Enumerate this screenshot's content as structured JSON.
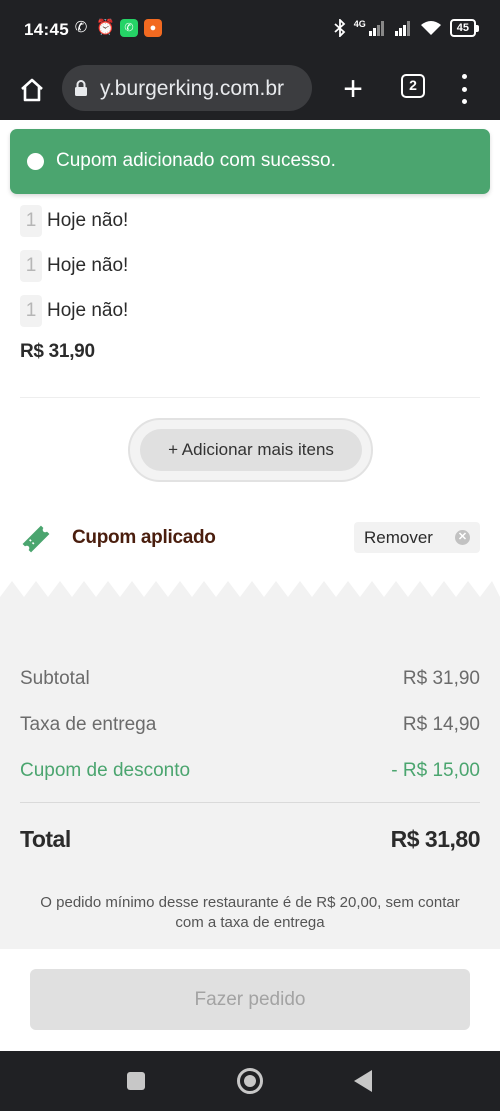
{
  "status_bar": {
    "time": "14:45",
    "network": "4G",
    "battery": "45",
    "icons": [
      "missed-call-icon",
      "alarm-icon",
      "whatsapp-icon",
      "app-notification-icon",
      "bluetooth-icon",
      "signal-icon",
      "wifi-icon",
      "battery-icon"
    ]
  },
  "browser": {
    "url": "y.burgerking.com.br",
    "tab_count": "2",
    "icons": [
      "home-icon",
      "lock-icon",
      "new-tab-icon",
      "tabs-icon",
      "menu-icon"
    ]
  },
  "toast": {
    "message": "Cupom adicionado com sucesso.",
    "color": "#4ba56f"
  },
  "cart": {
    "items": [
      {
        "qty": "1",
        "name": "Hoje não!"
      },
      {
        "qty": "1",
        "name": "Hoje não!"
      },
      {
        "qty": "1",
        "name": "Hoje não!"
      }
    ],
    "item_price": "R$ 31,90",
    "add_more_label": "+ Adicionar mais itens"
  },
  "coupon": {
    "label": "Cupom aplicado",
    "remove_label": "Remover",
    "icon": "ticket-icon",
    "icon_color": "#4ba56f"
  },
  "summary": {
    "subtotal_label": "Subtotal",
    "subtotal_value": "R$ 31,90",
    "delivery_label": "Taxa de entrega",
    "delivery_value": "R$ 14,90",
    "discount_label": "Cupom de desconto",
    "discount_value": "- R$ 15,00",
    "total_label": "Total",
    "total_value": "R$ 31,80",
    "minimum_note": "O pedido mínimo desse restaurante é de R$ 20,00, sem contar com a taxa de entrega"
  },
  "order_button": {
    "label": "Fazer pedido",
    "enabled": false
  },
  "navbar": {
    "icons": [
      "recents-icon",
      "home-nav-icon",
      "back-icon"
    ]
  }
}
